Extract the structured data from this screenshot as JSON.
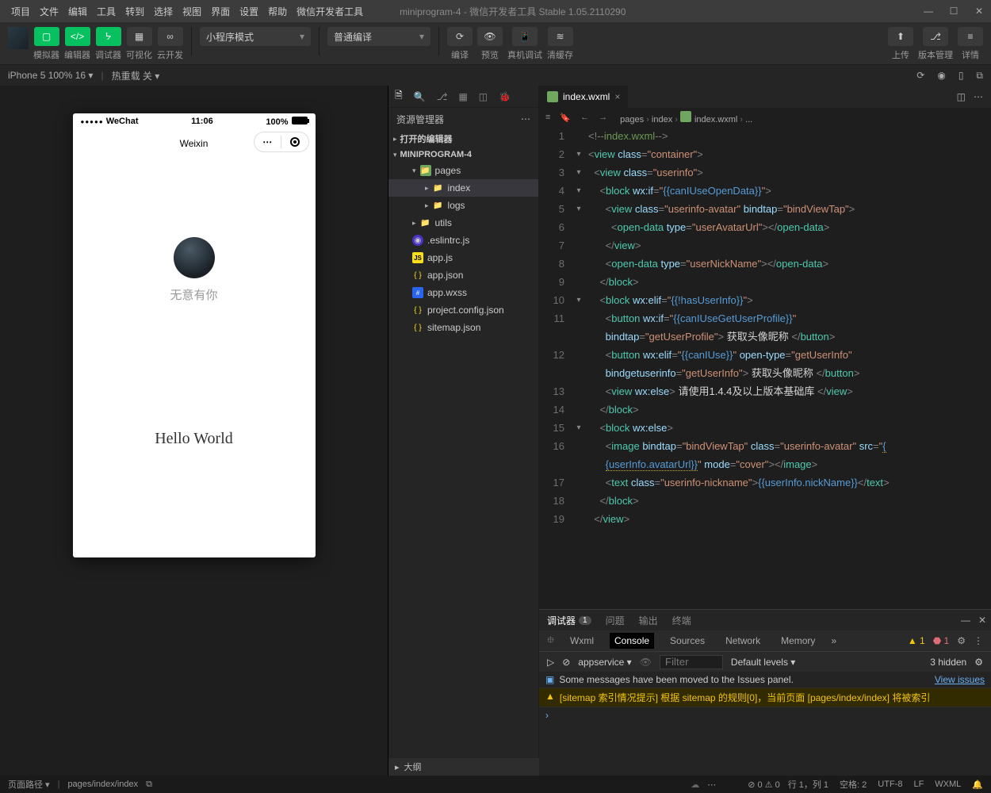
{
  "menus": [
    "项目",
    "文件",
    "编辑",
    "工具",
    "转到",
    "选择",
    "视图",
    "界面",
    "设置",
    "帮助",
    "微信开发者工具"
  ],
  "title": "miniprogram-4 - 微信开发者工具 Stable 1.05.2110290",
  "toolbar": {
    "sim": "模拟器",
    "editor": "编辑器",
    "debugger": "调试器",
    "visual": "可视化",
    "cloud": "云开发",
    "mode": "小程序模式",
    "compileType": "普通编译",
    "compile": "编译",
    "preview": "预览",
    "remote": "真机调试",
    "clear": "清缓存",
    "upload": "上传",
    "version": "版本管理",
    "detail": "详情"
  },
  "subbar": {
    "device": "iPhone 5 100% 16",
    "hot": "热重载 关"
  },
  "phone": {
    "carrier": "WeChat",
    "time": "11:06",
    "batt": "100%",
    "title": "Weixin",
    "nickname": "无意有你",
    "hello": "Hello World"
  },
  "explorer": {
    "title": "资源管理器",
    "opened": "打开的编辑器",
    "project": "MINIPROGRAM-4",
    "tree": [
      {
        "l": 1,
        "icon": "folder-g",
        "label": "pages",
        "chev": "▾"
      },
      {
        "l": 2,
        "icon": "folder",
        "label": "index",
        "chev": "▸",
        "sel": true
      },
      {
        "l": 2,
        "icon": "folder",
        "label": "logs",
        "chev": "▸"
      },
      {
        "l": 1,
        "icon": "folder",
        "label": "utils",
        "chev": "▸"
      },
      {
        "l": 1,
        "icon": "eslint",
        "label": ".eslintrc.js"
      },
      {
        "l": 1,
        "icon": "js",
        "label": "app.js"
      },
      {
        "l": 1,
        "icon": "json",
        "label": "app.json"
      },
      {
        "l": 1,
        "icon": "wxss",
        "label": "app.wxss"
      },
      {
        "l": 1,
        "icon": "json",
        "label": "project.config.json"
      },
      {
        "l": 1,
        "icon": "json",
        "label": "sitemap.json"
      }
    ],
    "outline": "大纲"
  },
  "editorTab": "index.wxml",
  "crumbs": [
    "pages",
    "index",
    "index.wxml",
    "..."
  ],
  "code": [
    {
      "n": 1,
      "fold": "",
      "ind": 0,
      "html": "<span class='c-pun'>&lt;!--</span><span class='c-cm'>index.wxml</span><span class='c-pun'>--&gt;</span>"
    },
    {
      "n": 2,
      "fold": "▾",
      "ind": 0,
      "html": "<span class='c-pun'>&lt;</span><span class='c-tag'>view</span> <span class='c-attr'>class</span><span class='c-pun'>=</span><span class='c-str'>\"container\"</span><span class='c-pun'>&gt;</span>"
    },
    {
      "n": 3,
      "fold": "▾",
      "ind": 1,
      "html": "<span class='c-pun'>&lt;</span><span class='c-tag'>view</span> <span class='c-attr'>class</span><span class='c-pun'>=</span><span class='c-str'>\"userinfo\"</span><span class='c-pun'>&gt;</span>"
    },
    {
      "n": 4,
      "fold": "▾",
      "ind": 2,
      "html": "<span class='c-pun'>&lt;</span><span class='c-tag'>block</span> <span class='c-attr'>wx:if</span><span class='c-pun'>=</span><span class='c-str'>\"</span><span class='c-op'>{{canIUseOpenData}}</span><span class='c-str'>\"</span><span class='c-pun'>&gt;</span>"
    },
    {
      "n": 5,
      "fold": "▾",
      "ind": 3,
      "html": "<span class='c-pun'>&lt;</span><span class='c-tag'>view</span> <span class='c-attr'>class</span><span class='c-pun'>=</span><span class='c-str'>\"userinfo-avatar\"</span> <span class='c-attr'>bindtap</span><span class='c-pun'>=</span><span class='c-str'>\"bindViewTap\"</span><span class='c-pun'>&gt;</span>"
    },
    {
      "n": 6,
      "fold": "",
      "ind": 4,
      "html": "<span class='c-pun'>&lt;</span><span class='c-tag'>open-data</span> <span class='c-attr'>type</span><span class='c-pun'>=</span><span class='c-str'>\"userAvatarUrl\"</span><span class='c-pun'>&gt;&lt;/</span><span class='c-tag'>open-data</span><span class='c-pun'>&gt;</span>"
    },
    {
      "n": 7,
      "fold": "",
      "ind": 3,
      "html": "<span class='c-pun'>&lt;/</span><span class='c-tag'>view</span><span class='c-pun'>&gt;</span>"
    },
    {
      "n": 8,
      "fold": "",
      "ind": 3,
      "html": "<span class='c-pun'>&lt;</span><span class='c-tag'>open-data</span> <span class='c-attr'>type</span><span class='c-pun'>=</span><span class='c-str'>\"userNickName\"</span><span class='c-pun'>&gt;&lt;/</span><span class='c-tag'>open-data</span><span class='c-pun'>&gt;</span>"
    },
    {
      "n": 9,
      "fold": "",
      "ind": 2,
      "html": "<span class='c-pun'>&lt;/</span><span class='c-tag'>block</span><span class='c-pun'>&gt;</span>"
    },
    {
      "n": 10,
      "fold": "▾",
      "ind": 2,
      "html": "<span class='c-pun'>&lt;</span><span class='c-tag'>block</span> <span class='c-attr'>wx:elif</span><span class='c-pun'>=</span><span class='c-str'>\"</span><span class='c-op'>{{!hasUserInfo}}</span><span class='c-str'>\"</span><span class='c-pun'>&gt;</span>"
    },
    {
      "n": 11,
      "fold": "",
      "ind": 3,
      "html": "<span class='c-pun'>&lt;</span><span class='c-tag'>button</span> <span class='c-attr'>wx:if</span><span class='c-pun'>=</span><span class='c-str'>\"</span><span class='c-op'>{{canIUseGetUserProfile}}</span><span class='c-str'>\"</span> "
    },
    {
      "n": "",
      "fold": "",
      "ind": 3,
      "html": "<span class='c-attr'>bindtap</span><span class='c-pun'>=</span><span class='c-str'>\"getUserProfile\"</span><span class='c-pun'>&gt;</span><span class='c-text'> 获取头像昵称 </span><span class='c-pun'>&lt;/</span><span class='c-tag'>button</span><span class='c-pun'>&gt;</span>"
    },
    {
      "n": 12,
      "fold": "",
      "ind": 3,
      "html": "<span class='c-pun'>&lt;</span><span class='c-tag'>button</span> <span class='c-attr'>wx:elif</span><span class='c-pun'>=</span><span class='c-str'>\"</span><span class='c-op'>{{canIUse}}</span><span class='c-str'>\"</span> <span class='c-attr'>open-type</span><span class='c-pun'>=</span><span class='c-str'>\"getUserInfo\"</span> "
    },
    {
      "n": "",
      "fold": "",
      "ind": 3,
      "html": "<span class='c-attr'>bindgetuserinfo</span><span class='c-pun'>=</span><span class='c-str'>\"getUserInfo\"</span><span class='c-pun'>&gt;</span><span class='c-text'> 获取头像昵称 </span><span class='c-pun'>&lt;/</span><span class='c-tag'>button</span><span class='c-pun'>&gt;</span>"
    },
    {
      "n": 13,
      "fold": "",
      "ind": 3,
      "html": "<span class='c-pun'>&lt;</span><span class='c-tag'>view</span> <span class='c-attr'>wx:else</span><span class='c-pun'>&gt;</span><span class='c-text'> 请使用1.4.4及以上版本基础库 </span><span class='c-pun'>&lt;/</span><span class='c-tag'>view</span><span class='c-pun'>&gt;</span>"
    },
    {
      "n": 14,
      "fold": "",
      "ind": 2,
      "html": "<span class='c-pun'>&lt;/</span><span class='c-tag'>block</span><span class='c-pun'>&gt;</span>"
    },
    {
      "n": 15,
      "fold": "▾",
      "ind": 2,
      "html": "<span class='c-pun'>&lt;</span><span class='c-tag'>block</span> <span class='c-attr'>wx:else</span><span class='c-pun'>&gt;</span>"
    },
    {
      "n": 16,
      "fold": "",
      "ind": 3,
      "html": "<span class='c-pun'>&lt;</span><span class='c-tag'>image</span> <span class='c-attr'>bindtap</span><span class='c-pun'>=</span><span class='c-str'>\"bindViewTap\"</span> <span class='c-attr'>class</span><span class='c-pun'>=</span><span class='c-str'>\"userinfo-avatar\"</span> <span class='c-attr'>src</span><span class='c-pun'>=</span><span class='c-str'>\"</span><span class='c-op c-warn'>{</span>"
    },
    {
      "n": "",
      "fold": "",
      "ind": 3,
      "html": "<span class='c-op c-warn'>{userInfo.avatarUrl}}</span><span class='c-str'>\"</span> <span class='c-attr'>mode</span><span class='c-pun'>=</span><span class='c-str'>\"cover\"</span><span class='c-pun'>&gt;&lt;/</span><span class='c-tag'>image</span><span class='c-pun'>&gt;</span>"
    },
    {
      "n": 17,
      "fold": "",
      "ind": 3,
      "html": "<span class='c-pun'>&lt;</span><span class='c-tag'>text</span> <span class='c-attr'>class</span><span class='c-pun'>=</span><span class='c-str'>\"userinfo-nickname\"</span><span class='c-pun'>&gt;</span><span class='c-op'>{{userInfo.nickName}}</span><span class='c-pun'>&lt;/</span><span class='c-tag'>text</span><span class='c-pun'>&gt;</span>"
    },
    {
      "n": 18,
      "fold": "",
      "ind": 2,
      "html": "<span class='c-pun'>&lt;/</span><span class='c-tag'>block</span><span class='c-pun'>&gt;</span>"
    },
    {
      "n": 19,
      "fold": "",
      "ind": 1,
      "html": "<span class='c-pun'>&lt;/</span><span class='c-tag'>view</span><span class='c-pun'>&gt;</span>"
    }
  ],
  "console": {
    "tabs": [
      "调试器",
      "问题",
      "输出",
      "终端"
    ],
    "badge": "1",
    "devtabs": [
      "Wxml",
      "Console",
      "Sources",
      "Network",
      "Memory"
    ],
    "warnCount": "1",
    "errCount": "1",
    "hidden": "3 hidden",
    "context": "appservice",
    "levels": "Default levels",
    "filterPh": "Filter",
    "info": "Some messages have been moved to the Issues panel.",
    "viewIssues": "View issues",
    "warn": "[sitemap 索引情况提示] 根据 sitemap 的规则[0]，当前页面 [pages/index/index] 将被索引"
  },
  "statusbar": {
    "pathLabel": "页面路径",
    "path": "pages/index/index",
    "diag": "⊘ 0 ⚠ 0",
    "pos": "行 1，列 1",
    "spaces": "空格: 2",
    "enc": "UTF-8",
    "eol": "LF",
    "lang": "WXML"
  }
}
